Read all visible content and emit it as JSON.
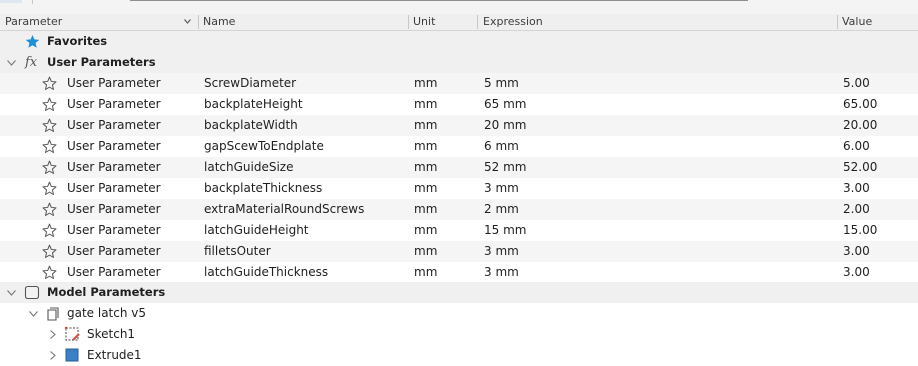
{
  "header": {
    "parameter": "Parameter",
    "name": "Name",
    "unit": "Unit",
    "expression": "Expression",
    "value": "Value"
  },
  "favorites": {
    "label": "Favorites"
  },
  "user_parameters": {
    "label": "User Parameters",
    "icon_text": "fx",
    "rows": [
      {
        "type": "User Parameter",
        "name": "ScrewDiameter",
        "unit": "mm",
        "expression": "5 mm",
        "value": "5.00"
      },
      {
        "type": "User Parameter",
        "name": "backplateHeight",
        "unit": "mm",
        "expression": "65 mm",
        "value": "65.00"
      },
      {
        "type": "User Parameter",
        "name": "backplateWidth",
        "unit": "mm",
        "expression": "20 mm",
        "value": "20.00"
      },
      {
        "type": "User Parameter",
        "name": "gapScewToEndplate",
        "unit": "mm",
        "expression": "6 mm",
        "value": "6.00"
      },
      {
        "type": "User Parameter",
        "name": "latchGuideSize",
        "unit": "mm",
        "expression": "52 mm",
        "value": "52.00"
      },
      {
        "type": "User Parameter",
        "name": "backplateThickness",
        "unit": "mm",
        "expression": "3 mm",
        "value": "3.00"
      },
      {
        "type": "User Parameter",
        "name": "extraMaterialRoundScrews",
        "unit": "mm",
        "expression": "2 mm",
        "value": "2.00"
      },
      {
        "type": "User Parameter",
        "name": "latchGuideHeight",
        "unit": "mm",
        "expression": "15 mm",
        "value": "15.00"
      },
      {
        "type": "User Parameter",
        "name": "filletsOuter",
        "unit": "mm",
        "expression": "3 mm",
        "value": "3.00"
      },
      {
        "type": "User Parameter",
        "name": "latchGuideThickness",
        "unit": "mm",
        "expression": "3 mm",
        "value": "3.00"
      }
    ]
  },
  "model_parameters": {
    "label": "Model Parameters",
    "component": "gate latch v5",
    "children": [
      "Sketch1",
      "Extrude1"
    ]
  },
  "colors": {
    "accent": "#1f8fd6",
    "header_bg": "#efefef",
    "row_alt": "#f5f5f5",
    "sketch_red": "#d94a3a"
  }
}
